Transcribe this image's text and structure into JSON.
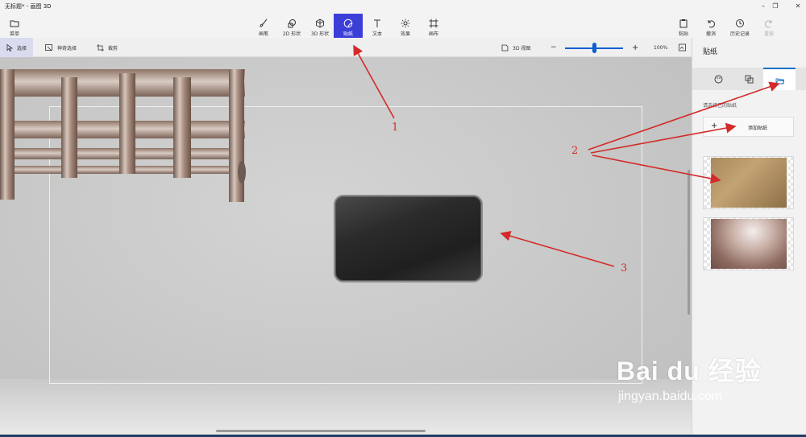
{
  "window": {
    "title": "无标题* - 画图 3D"
  },
  "toolbar": {
    "menu_label": "菜单",
    "tools": [
      {
        "label": "画笔",
        "icon": "brush-icon"
      },
      {
        "label": "2D 形状",
        "icon": "2d-shapes-icon"
      },
      {
        "label": "3D 形状",
        "icon": "3d-shapes-icon"
      },
      {
        "label": "贴纸",
        "icon": "stickers-icon",
        "active": true
      },
      {
        "label": "文本",
        "icon": "text-icon"
      },
      {
        "label": "效果",
        "icon": "effects-icon"
      },
      {
        "label": "画布",
        "icon": "canvas-icon"
      }
    ],
    "right": [
      {
        "label": "粘贴",
        "icon": "paste-icon"
      },
      {
        "label": "撤消",
        "icon": "undo-icon"
      },
      {
        "label": "历史记录",
        "icon": "history-icon"
      },
      {
        "label": "重做",
        "icon": "redo-icon",
        "disabled": true
      }
    ]
  },
  "subbar": {
    "select_label": "选择",
    "magic_select_label": "神奇选择",
    "crop_label": "裁剪",
    "view3d_label": "3D 视图",
    "zoom_level": "100%",
    "zoom_fraction": 0.5
  },
  "panel": {
    "title": "贴纸",
    "hint": "请选择已的贴纸",
    "add_label": "添加贴纸",
    "add_symbol": "+"
  },
  "annotations": {
    "n1": "1",
    "n2": "2",
    "n3": "3",
    "color": "#d42a2a"
  },
  "watermark": {
    "brand": "Bai du 经验",
    "url": "jingyan.baidu.com"
  }
}
